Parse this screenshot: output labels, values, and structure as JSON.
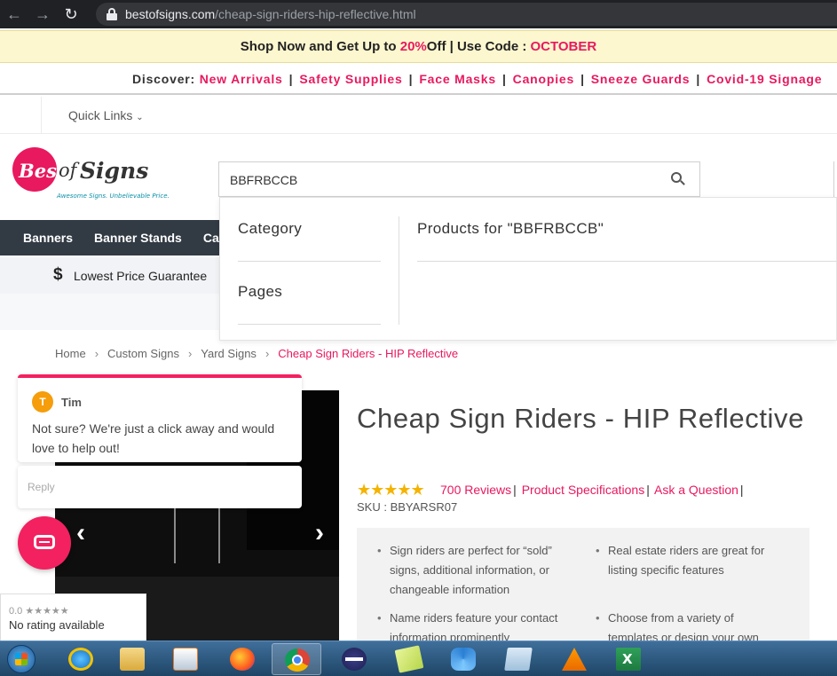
{
  "browser": {
    "url_host": "bestofsigns.com",
    "url_path": "/cheap-sign-riders-hip-reflective.html"
  },
  "promo": {
    "prefix": "Shop Now and Get Up to ",
    "percent": "20%",
    "middle": " Off | Use Code : ",
    "code": "OCTOBER"
  },
  "discover": {
    "label": "Discover:",
    "links": [
      "New Arrivals",
      "Safety Supplies",
      "Face Masks",
      "Canopies",
      "Sneeze Guards",
      "Covid-19 Signage"
    ]
  },
  "quick_links": "Quick Links",
  "logo": {
    "best": "Best",
    "of": "of",
    "signs": "Signs",
    "tagline": "Awesome Signs. Unbelievable Price."
  },
  "search": {
    "value": "BBFRBCCB"
  },
  "nav": {
    "items": [
      "Banners",
      "Banner Stands",
      "Ca"
    ]
  },
  "guarantee": {
    "symbol": "$",
    "text": "Lowest Price Guarantee"
  },
  "dropdown": {
    "category": "Category",
    "pages": "Pages",
    "products": "Products for \"BBFRBCCB\""
  },
  "breadcrumb": {
    "items": [
      "Home",
      "Custom Signs",
      "Yard Signs"
    ],
    "current": "Cheap Sign Riders - HIP Reflective"
  },
  "chat": {
    "avatar_letter": "T",
    "agent": "Tim",
    "message": "Not sure? We're just a click away and would love to help out!",
    "reply_placeholder": "Reply"
  },
  "rating_widget": {
    "score": "0.0 ★★★★★",
    "text": "No rating available"
  },
  "product": {
    "title": "Cheap Sign Riders - HIP Reflective",
    "stars": "★★★★★",
    "rating": 4.5,
    "reviews": "700 Reviews",
    "specs": "Product Specifications",
    "ask": "Ask a Question",
    "sku": "SKU : BBYARSR07",
    "features": [
      "Sign riders are perfect for “sold” signs, additional information, or changeable information",
      "Real estate riders are great for listing specific features",
      "Name riders feature your contact information prominently",
      "Choose from a variety of templates or design your own"
    ]
  },
  "colors": {
    "accent": "#e8195e",
    "nav_bg": "#323a44",
    "promo_bg": "#fdf7cf",
    "star": "#f5b301"
  }
}
